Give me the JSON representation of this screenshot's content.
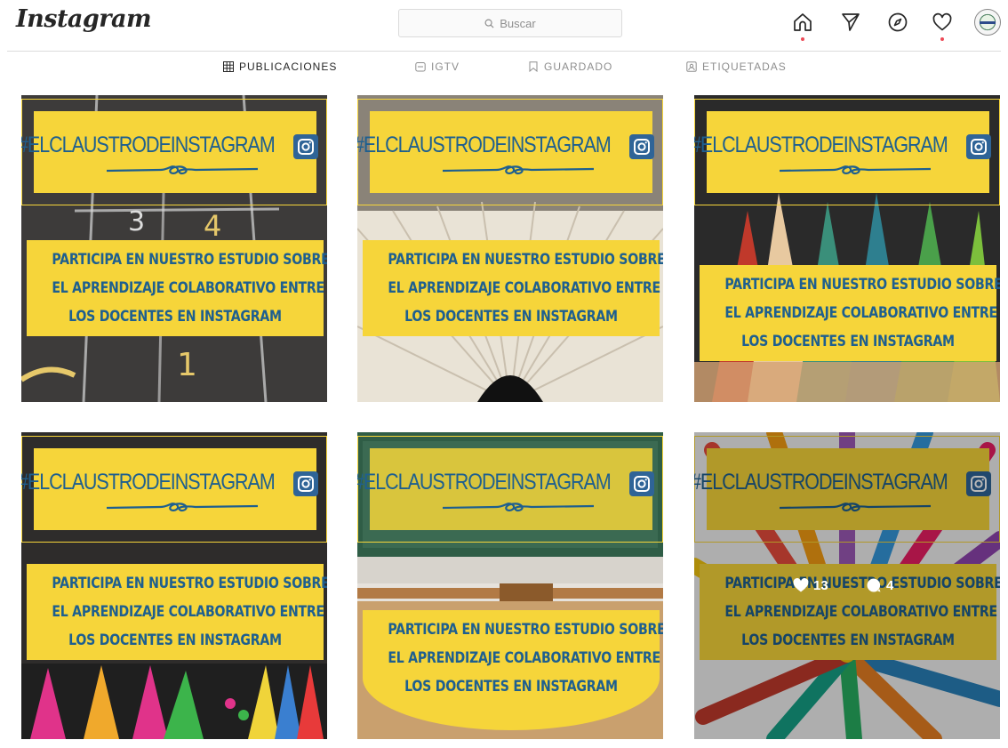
{
  "header": {
    "logo": "Instagram",
    "search_placeholder": "Buscar",
    "icons": [
      "home-icon",
      "direct-icon",
      "explore-icon",
      "activity-icon",
      "profile-avatar"
    ]
  },
  "tabs": [
    {
      "label": "PUBLICACIONES",
      "icon": "grid-icon",
      "active": true
    },
    {
      "label": "IGTV",
      "icon": "igtv-icon",
      "active": false
    },
    {
      "label": "GUARDADO",
      "icon": "bookmark-icon",
      "active": false
    },
    {
      "label": "ETIQUETADAS",
      "icon": "tagged-icon",
      "active": false
    }
  ],
  "posts": [
    {
      "hashtag": "#ELCLAUSTRODEINSTAGRAM",
      "lines": [
        "PARTICIPA EN NUESTRO ESTUDIO SOBRE",
        "EL APRENDIZAJE COLABORATIVO ENTRE",
        "LOS DOCENTES EN INSTAGRAM"
      ],
      "background": "chalkboard-hopscotch"
    },
    {
      "hashtag": "#ELCLAUSTRODEINSTAGRAM",
      "lines": [
        "PARTICIPA EN NUESTRO ESTUDIO SOBRE",
        "EL APRENDIZAJE COLABORATIVO ENTRE",
        "LOS DOCENTES EN INSTAGRAM"
      ],
      "background": "open-book"
    },
    {
      "hashtag": "#ELCLAUSTRODEINSTAGRAM",
      "lines": [
        "PARTICIPA EN NUESTRO ESTUDIO SOBRE",
        "EL APRENDIZAJE COLABORATIVO ENTRE",
        "LOS DOCENTES EN INSTAGRAM"
      ],
      "background": "colored-pencils"
    },
    {
      "hashtag": "#ELCLAUSTRODEINSTAGRAM",
      "lines": [
        "PARTICIPA EN NUESTRO ESTUDIO SOBRE",
        "EL APRENDIZAJE COLABORATIVO ENTRE",
        "LOS DOCENTES EN INSTAGRAM"
      ],
      "background": "school-supplies"
    },
    {
      "hashtag": "#ELCLAUSTRODEINSTAGRAM",
      "lines": [
        "PARTICIPA EN NUESTRO ESTUDIO SOBRE",
        "EL APRENDIZAJE COLABORATIVO ENTRE",
        "LOS DOCENTES EN INSTAGRAM"
      ],
      "background": "classroom-desks"
    },
    {
      "hashtag": "#ELCLAUSTRODEINSTAGRAM",
      "lines": [
        "PARTICIPA EN NUESTRO ESTUDIO SOBRE",
        "EL APRENDIZAJE COLABORATIVO ENTRE",
        "LOS DOCENTES EN INSTAGRAM"
      ],
      "background": "pencils-circle",
      "hover": {
        "likes": "13",
        "comments": "4"
      }
    }
  ],
  "colors": {
    "brand_yellow": "#f6d53a",
    "brand_blue": "#1e5f8f",
    "notification": "#ed4956"
  }
}
